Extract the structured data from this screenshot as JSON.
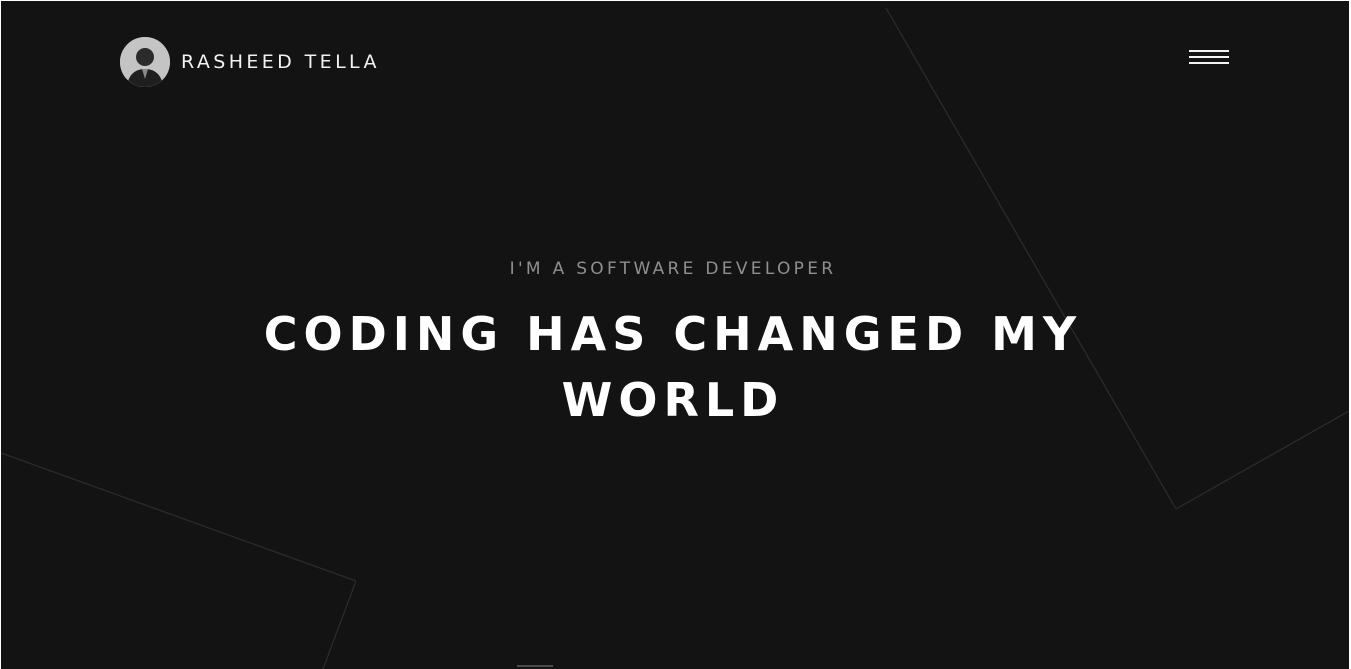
{
  "header": {
    "brand_name": "RASHEED TELLA",
    "avatar_icon": "user-photo-avatar",
    "menu_icon": "hamburger-menu-icon"
  },
  "hero": {
    "subtitle": "I'M A SOFTWARE DEVELOPER",
    "title": "CODING HAS CHANGED MY WORLD"
  },
  "colors": {
    "background": "#131313",
    "text_primary": "#ffffff",
    "text_muted": "#8f8f8f",
    "decor_lines": "#2c2c2c"
  }
}
